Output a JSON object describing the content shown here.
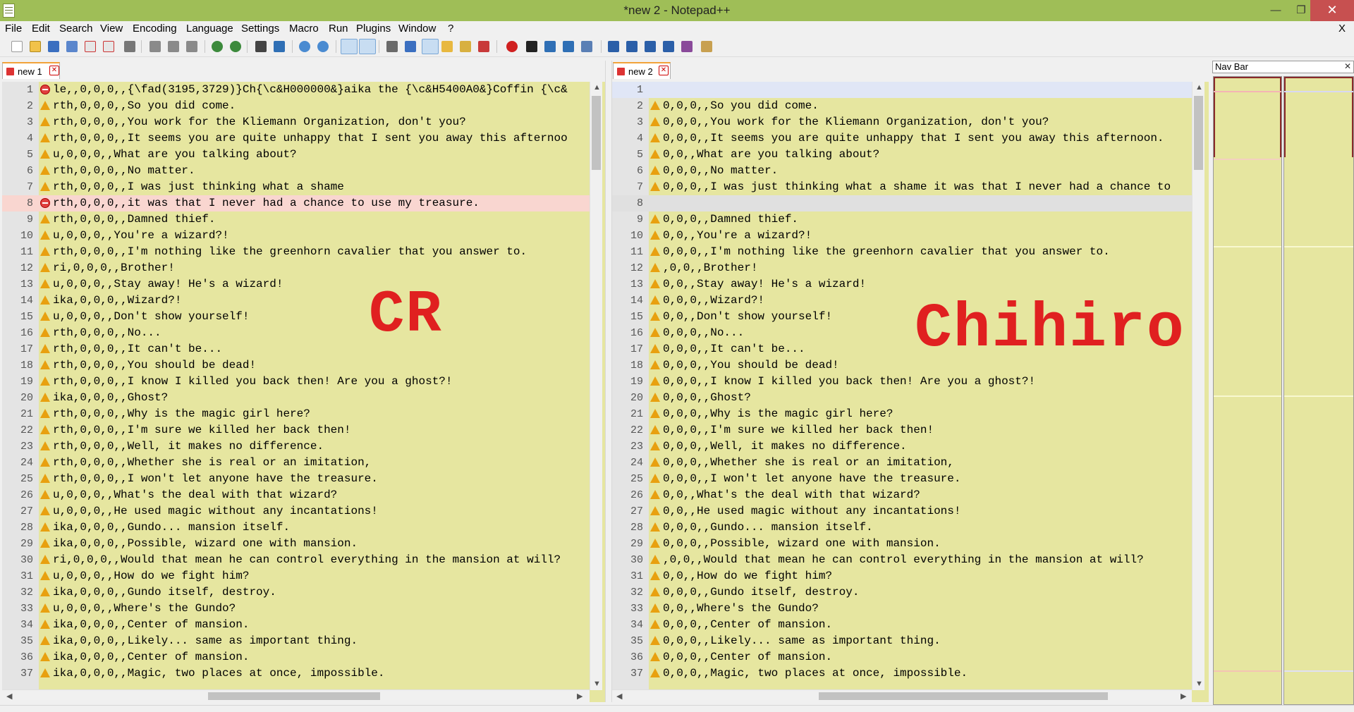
{
  "window": {
    "title": "*new  2 - Notepad++"
  },
  "menu": [
    "File",
    "Edit",
    "Search",
    "View",
    "Encoding",
    "Language",
    "Settings",
    "Macro",
    "Run",
    "Plugins",
    "Window",
    "?"
  ],
  "menu_close": "X",
  "left_pane": {
    "tab_label": "new  1",
    "overlay_text": "CR",
    "lines": [
      {
        "n": "1",
        "mark": "err",
        "hl": "",
        "text": "le,,0,0,0,,{\\fad(3195,3729)}Ch{\\c&H000000&}aika the {\\c&H5400A0&}Coffin {\\c&"
      },
      {
        "n": "2",
        "mark": "warn",
        "hl": "",
        "text": "rth,0,0,0,,So you did come."
      },
      {
        "n": "3",
        "mark": "warn",
        "hl": "",
        "text": "rth,0,0,0,,You work for the Kliemann Organization, don't you?"
      },
      {
        "n": "4",
        "mark": "warn",
        "hl": "",
        "text": "rth,0,0,0,,It seems you are quite unhappy that I sent you away this afternoo"
      },
      {
        "n": "5",
        "mark": "warn",
        "hl": "",
        "text": "u,0,0,0,,What are you talking about?"
      },
      {
        "n": "6",
        "mark": "warn",
        "hl": "",
        "text": "rth,0,0,0,,No matter."
      },
      {
        "n": "7",
        "mark": "warn",
        "hl": "",
        "text": "rth,0,0,0,,I was just thinking what a shame"
      },
      {
        "n": "8",
        "mark": "err",
        "hl": "red",
        "text": "rth,0,0,0,,it was that I never had a chance to use my treasure."
      },
      {
        "n": "9",
        "mark": "warn",
        "hl": "",
        "text": "rth,0,0,0,,Damned thief."
      },
      {
        "n": "10",
        "mark": "warn",
        "hl": "",
        "text": "u,0,0,0,,You're a wizard?!"
      },
      {
        "n": "11",
        "mark": "warn",
        "hl": "",
        "text": "rth,0,0,0,,I'm nothing like the greenhorn cavalier that you answer to."
      },
      {
        "n": "12",
        "mark": "warn",
        "hl": "",
        "text": "ri,0,0,0,,Brother!"
      },
      {
        "n": "13",
        "mark": "warn",
        "hl": "",
        "text": "u,0,0,0,,Stay away! He's a wizard!"
      },
      {
        "n": "14",
        "mark": "warn",
        "hl": "",
        "text": "ika,0,0,0,,Wizard?!"
      },
      {
        "n": "15",
        "mark": "warn",
        "hl": "",
        "text": "u,0,0,0,,Don't show yourself!"
      },
      {
        "n": "16",
        "mark": "warn",
        "hl": "",
        "text": "rth,0,0,0,,No..."
      },
      {
        "n": "17",
        "mark": "warn",
        "hl": "",
        "text": "rth,0,0,0,,It can't be..."
      },
      {
        "n": "18",
        "mark": "warn",
        "hl": "",
        "text": "rth,0,0,0,,You should be dead!"
      },
      {
        "n": "19",
        "mark": "warn",
        "hl": "",
        "text": "rth,0,0,0,,I know I killed you back then! Are you a ghost?!"
      },
      {
        "n": "20",
        "mark": "warn",
        "hl": "",
        "text": "ika,0,0,0,,Ghost?"
      },
      {
        "n": "21",
        "mark": "warn",
        "hl": "",
        "text": "rth,0,0,0,,Why is the magic girl here?"
      },
      {
        "n": "22",
        "mark": "warn",
        "hl": "",
        "text": "rth,0,0,0,,I'm sure we killed her back then!"
      },
      {
        "n": "23",
        "mark": "warn",
        "hl": "",
        "text": "rth,0,0,0,,Well, it makes no difference."
      },
      {
        "n": "24",
        "mark": "warn",
        "hl": "",
        "text": "rth,0,0,0,,Whether she is real or an imitation,"
      },
      {
        "n": "25",
        "mark": "warn",
        "hl": "",
        "text": "rth,0,0,0,,I won't let anyone have the treasure."
      },
      {
        "n": "26",
        "mark": "warn",
        "hl": "",
        "text": "u,0,0,0,,What's the deal with that wizard?"
      },
      {
        "n": "27",
        "mark": "warn",
        "hl": "",
        "text": "u,0,0,0,,He used magic without any incantations!"
      },
      {
        "n": "28",
        "mark": "warn",
        "hl": "",
        "text": "ika,0,0,0,,Gundo... mansion itself."
      },
      {
        "n": "29",
        "mark": "warn",
        "hl": "",
        "text": "ika,0,0,0,,Possible, wizard one with mansion."
      },
      {
        "n": "30",
        "mark": "warn",
        "hl": "",
        "text": "ri,0,0,0,,Would that mean he can control everything in the mansion at will?"
      },
      {
        "n": "31",
        "mark": "warn",
        "hl": "",
        "text": "u,0,0,0,,How do we fight him?"
      },
      {
        "n": "32",
        "mark": "warn",
        "hl": "",
        "text": "ika,0,0,0,,Gundo itself, destroy."
      },
      {
        "n": "33",
        "mark": "warn",
        "hl": "",
        "text": "u,0,0,0,,Where's the Gundo?"
      },
      {
        "n": "34",
        "mark": "warn",
        "hl": "",
        "text": "ika,0,0,0,,Center of mansion."
      },
      {
        "n": "35",
        "mark": "warn",
        "hl": "",
        "text": "ika,0,0,0,,Likely... same as important thing."
      },
      {
        "n": "36",
        "mark": "warn",
        "hl": "",
        "text": "ika,0,0,0,,Center of mansion."
      },
      {
        "n": "37",
        "mark": "warn",
        "hl": "",
        "text": "ika,0,0,0,,Magic, two places at once, impossible."
      }
    ]
  },
  "right_pane": {
    "tab_label": "new  2",
    "overlay_text": "Chihiro",
    "lines": [
      {
        "n": "1",
        "mark": "",
        "hl": "blue",
        "text": ""
      },
      {
        "n": "2",
        "mark": "warn",
        "hl": "",
        "text": "0,0,0,,So you did come."
      },
      {
        "n": "3",
        "mark": "warn",
        "hl": "",
        "text": "0,0,0,,You work for the Kliemann Organization, don't you?"
      },
      {
        "n": "4",
        "mark": "warn",
        "hl": "",
        "text": "0,0,0,,It seems you are quite unhappy that I sent you away this afternoon."
      },
      {
        "n": "5",
        "mark": "warn",
        "hl": "",
        "text": "0,0,,What are you talking about?"
      },
      {
        "n": "6",
        "mark": "warn",
        "hl": "",
        "text": "0,0,0,,No matter."
      },
      {
        "n": "7",
        "mark": "warn",
        "hl": "",
        "text": "0,0,0,,I was just thinking what a shame it was that I never had a chance to"
      },
      {
        "n": "8",
        "mark": "",
        "hl": "gray",
        "text": ""
      },
      {
        "n": "9",
        "mark": "warn",
        "hl": "",
        "text": "0,0,0,,Damned thief."
      },
      {
        "n": "10",
        "mark": "warn",
        "hl": "",
        "text": "0,0,,You're a wizard?!"
      },
      {
        "n": "11",
        "mark": "warn",
        "hl": "",
        "text": "0,0,0,,I'm nothing like the greenhorn cavalier that you answer to."
      },
      {
        "n": "12",
        "mark": "warn",
        "hl": "",
        "text": ",0,0,,Brother!"
      },
      {
        "n": "13",
        "mark": "warn",
        "hl": "",
        "text": "0,0,,Stay away! He's a wizard!"
      },
      {
        "n": "14",
        "mark": "warn",
        "hl": "",
        "text": "0,0,0,,Wizard?!"
      },
      {
        "n": "15",
        "mark": "warn",
        "hl": "",
        "text": "0,0,,Don't show yourself!"
      },
      {
        "n": "16",
        "mark": "warn",
        "hl": "",
        "text": "0,0,0,,No..."
      },
      {
        "n": "17",
        "mark": "warn",
        "hl": "",
        "text": "0,0,0,,It can't be..."
      },
      {
        "n": "18",
        "mark": "warn",
        "hl": "",
        "text": "0,0,0,,You should be dead!"
      },
      {
        "n": "19",
        "mark": "warn",
        "hl": "",
        "text": "0,0,0,,I know I killed you back then! Are you a ghost?!"
      },
      {
        "n": "20",
        "mark": "warn",
        "hl": "",
        "text": "0,0,0,,Ghost?"
      },
      {
        "n": "21",
        "mark": "warn",
        "hl": "",
        "text": "0,0,0,,Why is the magic girl here?"
      },
      {
        "n": "22",
        "mark": "warn",
        "hl": "",
        "text": "0,0,0,,I'm sure we killed her back then!"
      },
      {
        "n": "23",
        "mark": "warn",
        "hl": "",
        "text": "0,0,0,,Well, it makes no difference."
      },
      {
        "n": "24",
        "mark": "warn",
        "hl": "",
        "text": "0,0,0,,Whether she is real or an imitation,"
      },
      {
        "n": "25",
        "mark": "warn",
        "hl": "",
        "text": "0,0,0,,I won't let anyone have the treasure."
      },
      {
        "n": "26",
        "mark": "warn",
        "hl": "",
        "text": "0,0,,What's the deal with that wizard?"
      },
      {
        "n": "27",
        "mark": "warn",
        "hl": "",
        "text": "0,0,,He used magic without any incantations!"
      },
      {
        "n": "28",
        "mark": "warn",
        "hl": "",
        "text": "0,0,0,,Gundo... mansion itself."
      },
      {
        "n": "29",
        "mark": "warn",
        "hl": "",
        "text": "0,0,0,,Possible, wizard one with mansion."
      },
      {
        "n": "30",
        "mark": "warn",
        "hl": "",
        "text": ",0,0,,Would that mean he can control everything in the mansion at will?"
      },
      {
        "n": "31",
        "mark": "warn",
        "hl": "",
        "text": "0,0,,How do we fight him?"
      },
      {
        "n": "32",
        "mark": "warn",
        "hl": "",
        "text": "0,0,0,,Gundo itself, destroy."
      },
      {
        "n": "33",
        "mark": "warn",
        "hl": "",
        "text": "0,0,,Where's the Gundo?"
      },
      {
        "n": "34",
        "mark": "warn",
        "hl": "",
        "text": "0,0,0,,Center of mansion."
      },
      {
        "n": "35",
        "mark": "warn",
        "hl": "",
        "text": "0,0,0,,Likely... same as important thing."
      },
      {
        "n": "36",
        "mark": "warn",
        "hl": "",
        "text": "0,0,0,,Center of mansion."
      },
      {
        "n": "37",
        "mark": "warn",
        "hl": "",
        "text": "0,0,0,,Magic, two places at once, impossible."
      }
    ]
  },
  "nav_bar": {
    "title": "Nav Bar"
  },
  "colors": {
    "titlebar": "#9fbe57",
    "editor_bg": "#e6e6a0",
    "overlay_text": "#e02020",
    "warning": "#e8a010",
    "error": "#e04040"
  }
}
